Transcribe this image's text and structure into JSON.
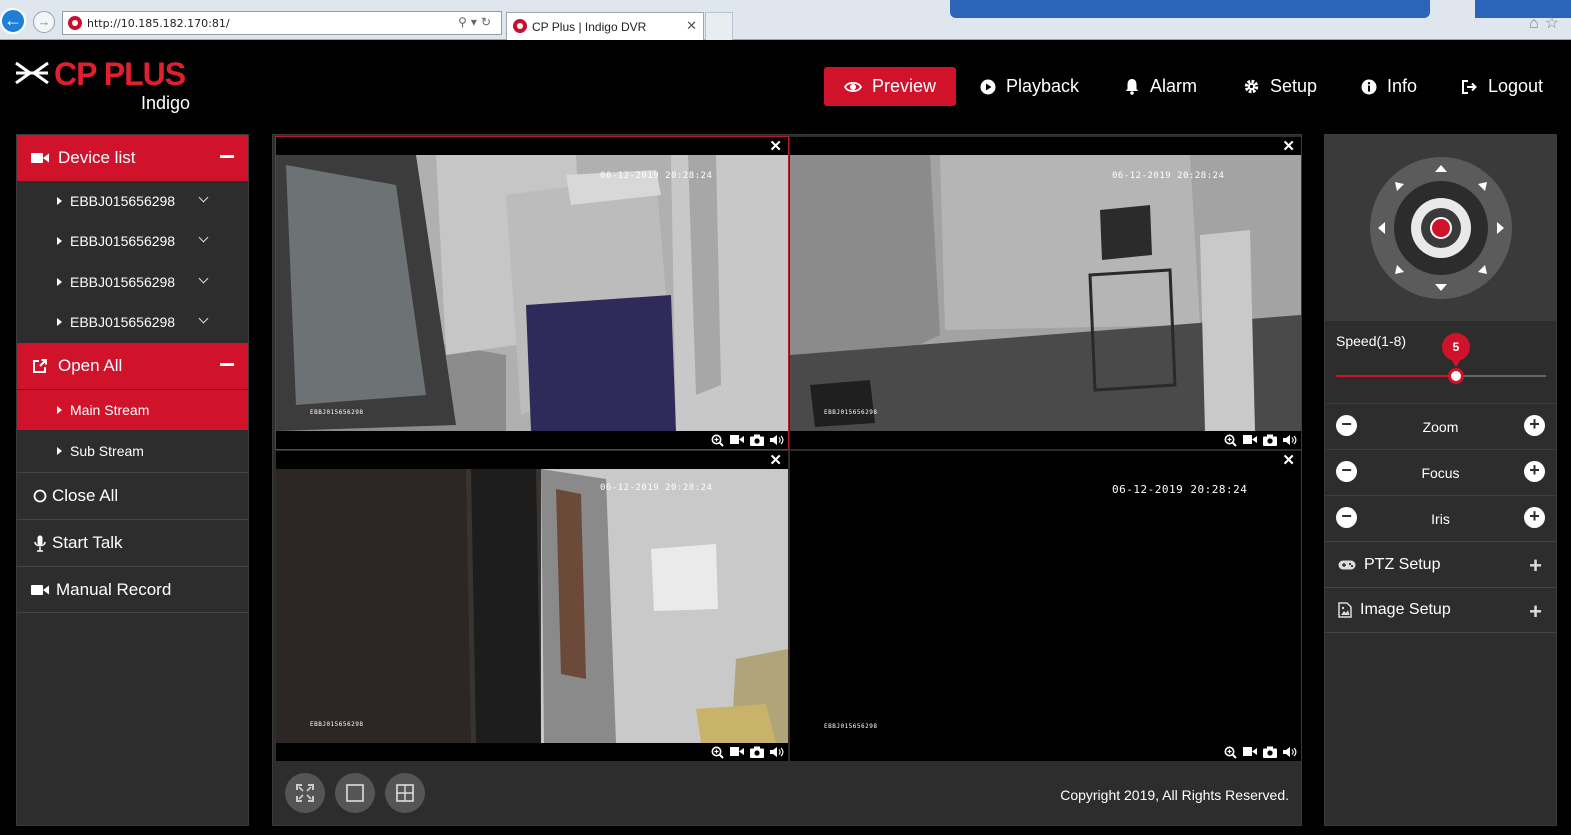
{
  "browser": {
    "url": "http://10.185.182.170:81/",
    "tab_title": "CP Plus | Indigo DVR"
  },
  "logo": {
    "name": "CP PLUS",
    "sub": "Indigo"
  },
  "nav": {
    "preview": "Preview",
    "playback": "Playback",
    "alarm": "Alarm",
    "setup": "Setup",
    "info": "Info",
    "logout": "Logout"
  },
  "left": {
    "device_list": "Device list",
    "devices": [
      "EBBJ015656298",
      "EBBJ015656298",
      "EBBJ015656298",
      "EBBJ015656298"
    ],
    "open_all": "Open All",
    "main_stream": "Main Stream",
    "sub_stream": "Sub Stream",
    "close_all": "Close All",
    "start_talk": "Start Talk",
    "manual_record": "Manual Record"
  },
  "tiles": [
    {
      "timestamp": "06-12-2019 20:28:24",
      "overlay": "EBBJ015656298"
    },
    {
      "timestamp": "06-12-2019 20:28:24",
      "overlay": "EBBJ015656298"
    },
    {
      "timestamp": "06-12-2019 20:28:24",
      "overlay": "EBBJ015656298"
    },
    {
      "timestamp": "06-12-2019 20:28:24",
      "overlay": "EBBJ015656298"
    }
  ],
  "footer": {
    "copyright": "Copyright 2019, All Rights Reserved."
  },
  "ptz": {
    "speed_label": "Speed(1-8)",
    "speed_value": "5",
    "speed_min": 1,
    "speed_max": 8,
    "zoom": "Zoom",
    "focus": "Focus",
    "iris": "Iris",
    "ptz_setup": "PTZ Setup",
    "image_setup": "Image Setup"
  },
  "colors": {
    "accent": "#d0132b",
    "panel": "#2d2d2d",
    "background": "#000000"
  }
}
